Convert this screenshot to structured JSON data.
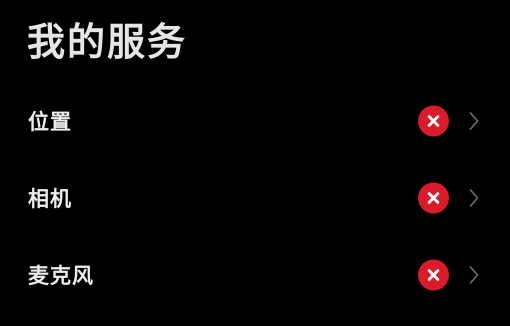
{
  "page": {
    "title": "我的服务"
  },
  "services": [
    {
      "label": "位置",
      "status": "disabled",
      "status_icon": "close-icon",
      "nav_icon": "chevron-right-icon"
    },
    {
      "label": "相机",
      "status": "disabled",
      "status_icon": "close-icon",
      "nav_icon": "chevron-right-icon"
    },
    {
      "label": "麦克风",
      "status": "disabled",
      "status_icon": "close-icon",
      "nav_icon": "chevron-right-icon"
    }
  ],
  "colors": {
    "background": "#000000",
    "text": "#ededed",
    "status_denied": "#d91c2b",
    "chevron": "#6e6e6e"
  }
}
